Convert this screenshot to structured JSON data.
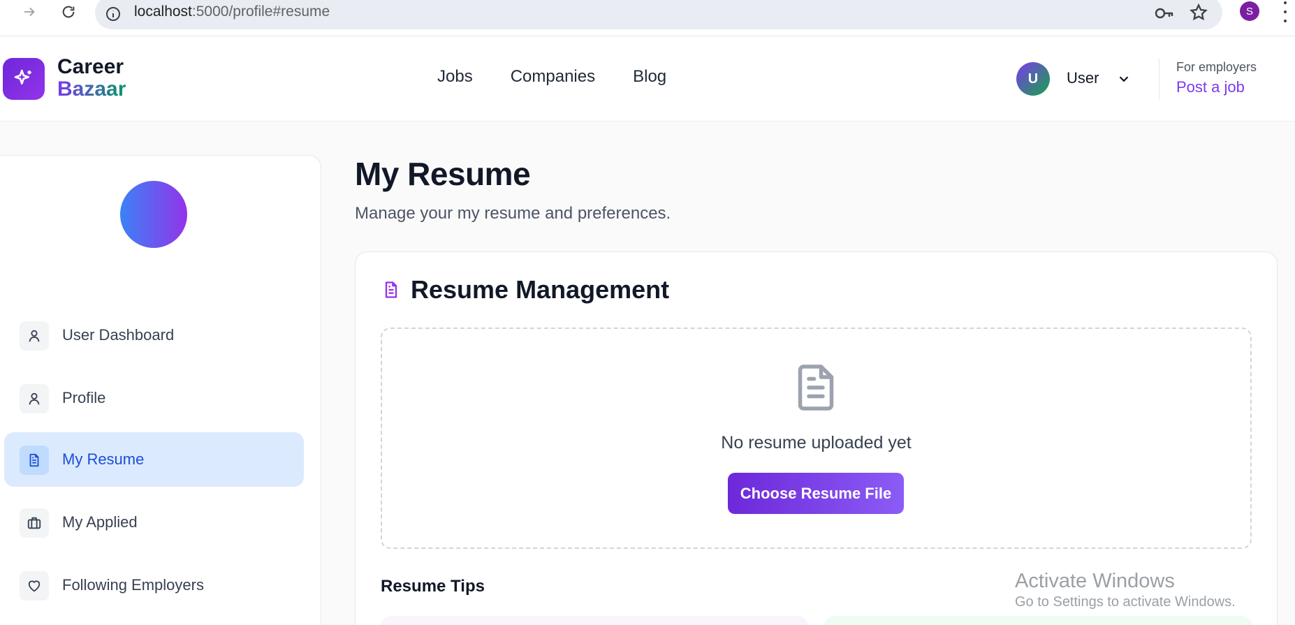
{
  "browser": {
    "url_host": "localhost",
    "url_path": ":5000/profile#resume",
    "profile_initial": "S"
  },
  "header": {
    "logo_line1": "Career",
    "logo_line2": "Bazaar",
    "nav": [
      "Jobs",
      "Companies",
      "Blog"
    ],
    "user_initial": "U",
    "user_name": "User",
    "for_employers": "For employers",
    "post_job": "Post a job"
  },
  "sidebar": {
    "items": [
      {
        "label": "User Dashboard",
        "icon": "user-icon"
      },
      {
        "label": "Profile",
        "icon": "user-icon"
      },
      {
        "label": "My Resume",
        "icon": "document-icon",
        "active": true
      },
      {
        "label": "My Applied",
        "icon": "briefcase-icon"
      },
      {
        "label": "Following Employers",
        "icon": "heart-icon"
      }
    ]
  },
  "main": {
    "title": "My Resume",
    "subtitle": "Manage your my resume and preferences.",
    "card_title": "Resume Management",
    "empty_text": "No resume uploaded yet",
    "choose_button": "Choose Resume File",
    "tips_title": "Resume Tips"
  },
  "watermark": {
    "line1": "Activate Windows",
    "line2": "Go to Settings to activate Windows."
  },
  "colors": {
    "brand": "#7c3aed",
    "active_bg": "#dbeafe",
    "active_text": "#1d4ed8"
  }
}
